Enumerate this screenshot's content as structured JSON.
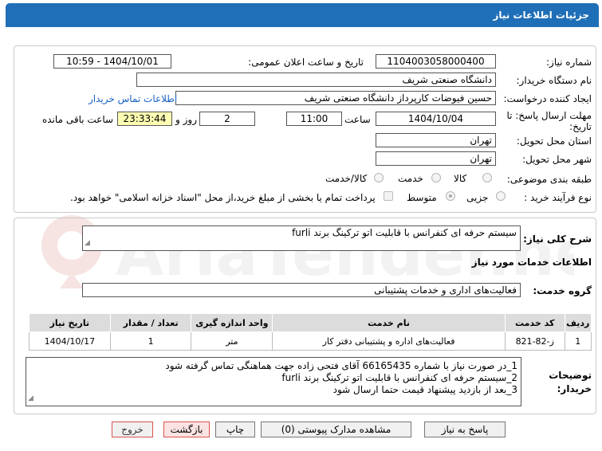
{
  "header": {
    "title": "جزئیات اطلاعات نیاز"
  },
  "form": {
    "need_number_label": "شماره نیاز:",
    "need_number": "1104003058000400",
    "announce_label": "تاریخ و ساعت اعلان عمومی:",
    "announce_value": "1404/10/01 - 10:59",
    "buyer_org_label": "نام دستگاه خریدار:",
    "buyer_org": "دانشگاه صنعتی شریف",
    "creator_label": "ایجاد کننده درخواست:",
    "creator": "حسین فیوضات کارپرداز دانشگاه صنعتی شریف",
    "contact_link": "اطلاعات تماس خریدار",
    "deadline_label": "مهلت ارسال پاسخ: تا تاریخ:",
    "deadline_date": "1404/10/04",
    "time_label": "ساعت",
    "deadline_time": "11:00",
    "days": "2",
    "days_label": "روز و",
    "remaining": "23:33:44",
    "remaining_label": "ساعت باقی مانده",
    "province_label": "استان محل تحویل:",
    "province": "تهران",
    "city_label": "شهر محل تحویل:",
    "city": "تهران",
    "category_label": "طبقه بندی موضوعی:",
    "cat_goods": "کالا",
    "cat_service": "خدمت",
    "cat_goods_service": "کالا/خدمت",
    "process_label": "نوع فرآیند خرید :",
    "proc_small": "جزیی",
    "proc_medium": "متوسط",
    "payment_note": "پرداخت تمام یا بخشی از مبلغ خرید،از محل \"اسناد خزانه اسلامی\" خواهد بود."
  },
  "summary": {
    "label": "شرح کلی نیاز:",
    "text": "سیستم حرفه ای کنفرانس با قابلیت اتو ترکینگ برند furli"
  },
  "services": {
    "section_title": "اطلاعات خدمات مورد نیاز",
    "group_label": "گروه خدمت:",
    "group_value": "فعالیت‌های اداری و خدمات پشتیبانی",
    "columns": [
      "ردیف",
      "کد خدمت",
      "نام خدمت",
      "واحد اندازه گیری",
      "تعداد / مقدار",
      "تاریخ نیاز"
    ],
    "rows": [
      [
        "1",
        "ز-82-821",
        "فعالیت‌های اداره و پشتیبانی دفتر کار",
        "متر",
        "1",
        "1404/10/17"
      ]
    ]
  },
  "notes": {
    "label": "توضیحات خریدار:",
    "lines": [
      "1_در صورت نیاز با شماره 66165435 آقای فتحی زاده جهت هماهنگی تماس گرفته شود",
      "2_سیستم حرفه ای کنفرانس با قابلیت اتو ترکینگ برند furli",
      "3_بعد از بازدید پیشنهاد قیمت حتما ارسال شود"
    ]
  },
  "buttons": {
    "reply": "پاسخ به نیاز",
    "attachments": "مشاهده مدارک پیوستی (0)",
    "print": "چاپ",
    "back": "بازگشت",
    "exit": "خروج"
  },
  "watermark": {
    "text": "AriaTender.net"
  }
}
